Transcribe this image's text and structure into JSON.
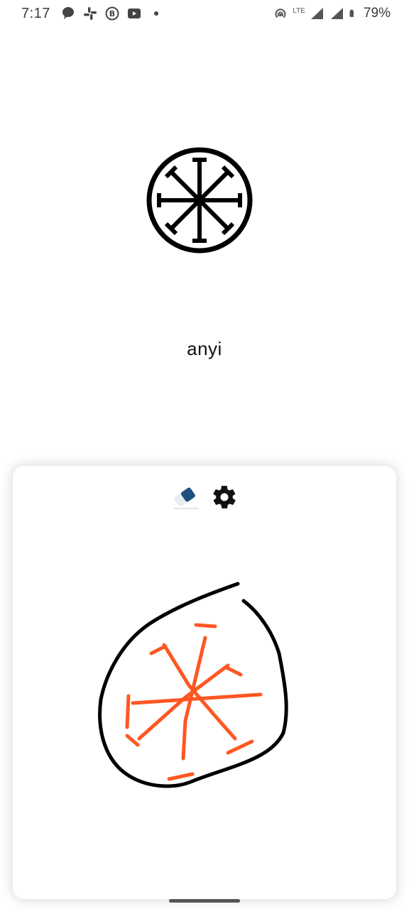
{
  "status_bar": {
    "time": "7:17",
    "left_icons": [
      "chat-bubble-icon",
      "slack-icon",
      "b-badge-icon",
      "youtube-icon",
      "dot-icon"
    ],
    "network": "LTE",
    "battery_percent": "79%"
  },
  "prompt": {
    "glyph_icon": "wheel-glyph",
    "word": "anyi"
  },
  "toolbar": {
    "eraser_icon": "eraser-icon",
    "settings_icon": "gear-icon"
  },
  "drawing": {
    "outline_color": "#000000",
    "stroke_color": "#ff5722"
  }
}
